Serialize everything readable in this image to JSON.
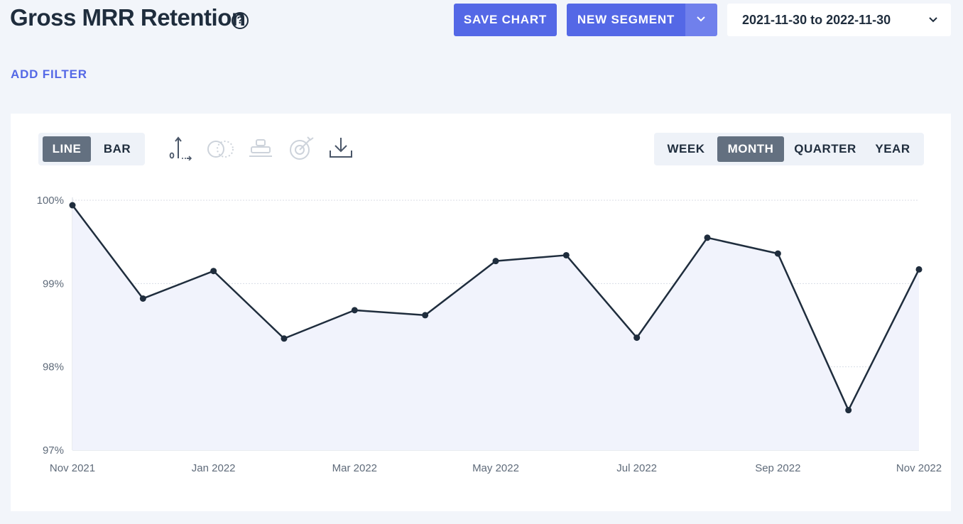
{
  "header": {
    "title": "Gross MRR Retention",
    "help_icon": "question-circle-icon",
    "save_label": "SAVE CHART",
    "segment_label": "NEW SEGMENT",
    "date_range": "2021-11-30 to 2022-11-30"
  },
  "filters": {
    "add_label": "ADD FILTER"
  },
  "toolbar": {
    "chart_types": [
      {
        "label": "LINE",
        "active": true
      },
      {
        "label": "BAR",
        "active": false
      }
    ],
    "tools": [
      "axis-icon",
      "compare-circles-icon",
      "stack-icon",
      "goal-target-icon",
      "download-icon"
    ],
    "periods": [
      {
        "label": "WEEK",
        "active": false
      },
      {
        "label": "MONTH",
        "active": true
      },
      {
        "label": "QUARTER",
        "active": false
      },
      {
        "label": "YEAR",
        "active": false
      }
    ]
  },
  "colors": {
    "accent": "#5468e6",
    "line": "#1f2d3d",
    "area": "#f1f3fc"
  },
  "chart_data": {
    "type": "area",
    "ylim": [
      97,
      100
    ],
    "y_ticks": [
      "100%",
      "99%",
      "98%",
      "97%"
    ],
    "x_ticks": [
      "Nov 2021",
      "Jan 2022",
      "Mar 2022",
      "May 2022",
      "Jul 2022",
      "Sep 2022",
      "Nov 2022"
    ],
    "x": [
      "2021-11",
      "2021-12",
      "2022-01",
      "2022-02",
      "2022-03",
      "2022-04",
      "2022-05",
      "2022-06",
      "2022-07",
      "2022-08",
      "2022-09",
      "2022-10",
      "2022-11"
    ],
    "values": [
      99.94,
      98.82,
      99.15,
      98.34,
      98.68,
      98.62,
      99.27,
      99.34,
      98.35,
      99.55,
      99.36,
      97.48,
      99.17
    ],
    "grid": true
  }
}
